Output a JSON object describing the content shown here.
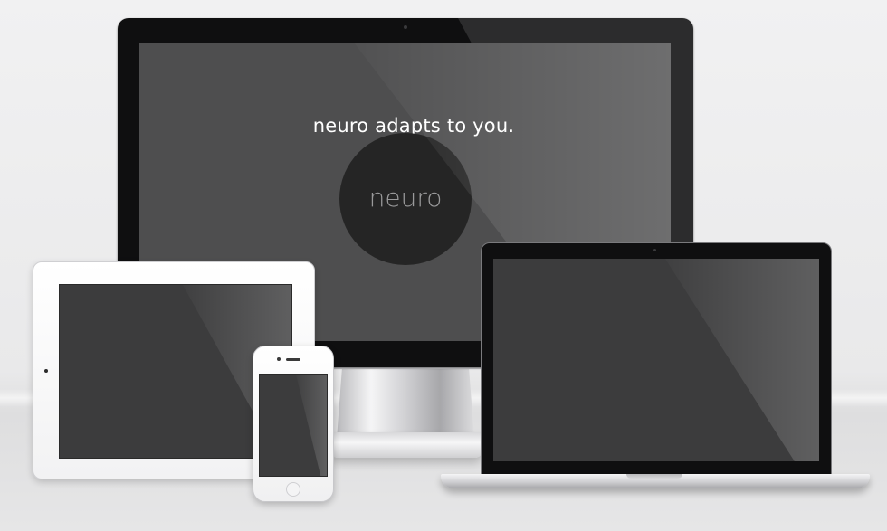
{
  "hero": {
    "tagline": "neuro adapts to you.",
    "logo_text": "neuro"
  },
  "devices": [
    "monitor",
    "tablet",
    "phone",
    "laptop"
  ],
  "colors": {
    "background": "#ececed",
    "screen": "#4e4e4f",
    "logo_circle": "#252525",
    "logo_text": "#9a9a9b",
    "tagline": "#ffffff"
  }
}
